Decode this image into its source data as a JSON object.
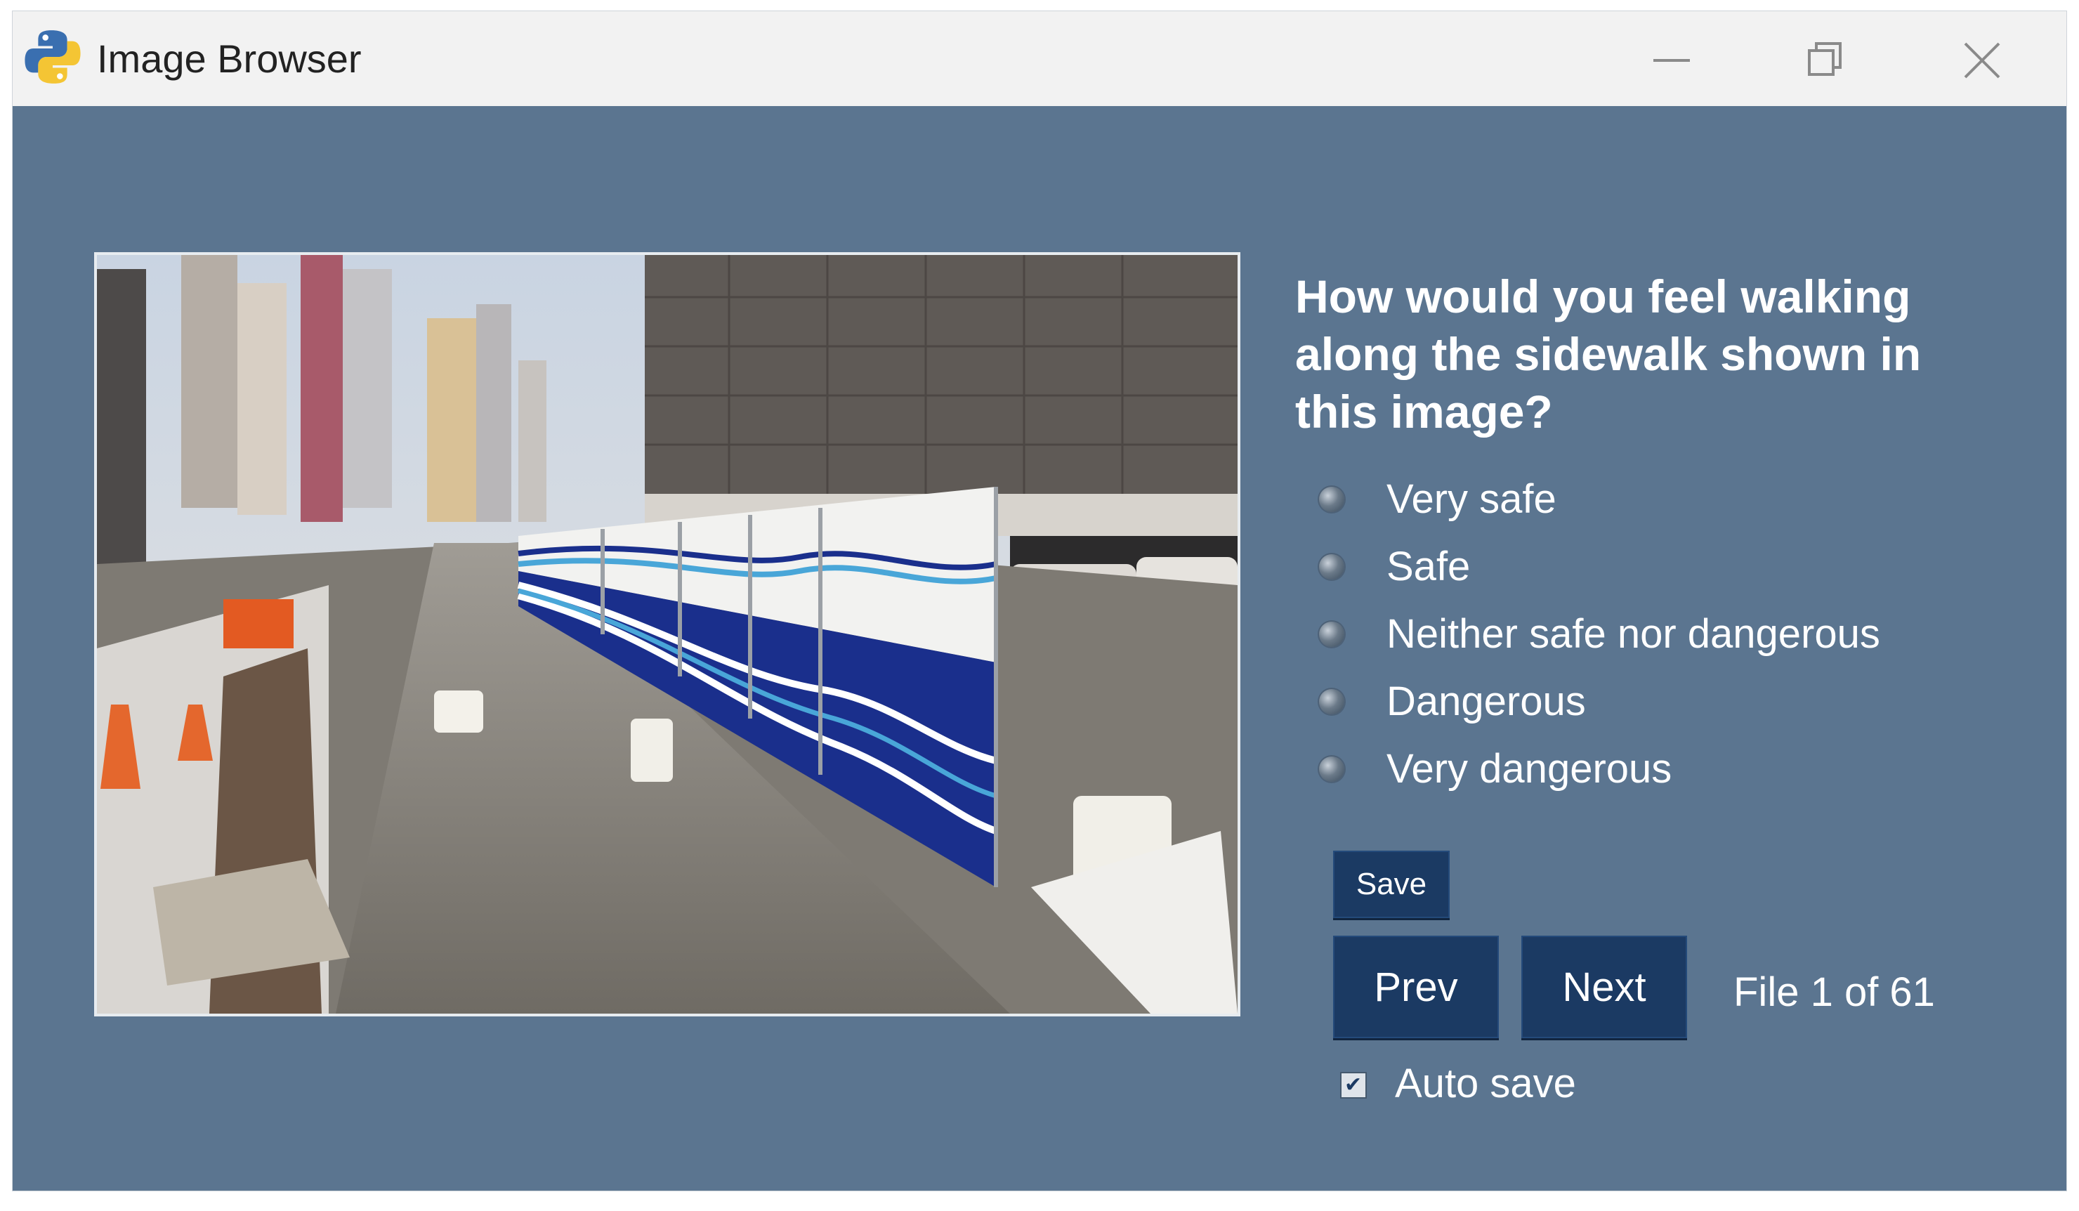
{
  "window": {
    "title": "Image Browser",
    "icon": "python-icon"
  },
  "titlebar_controls": [
    "minimize-icon",
    "restore-icon",
    "close-icon"
  ],
  "question": "How would you feel walking along the sidewalk shown in this image?",
  "options": [
    {
      "label": "Very safe",
      "selected": false
    },
    {
      "label": "Safe",
      "selected": false
    },
    {
      "label": "Neither safe nor dangerous",
      "selected": false
    },
    {
      "label": "Dangerous",
      "selected": false
    },
    {
      "label": "Very dangerous",
      "selected": false
    }
  ],
  "buttons": {
    "save": "Save",
    "prev": "Prev",
    "next": "Next"
  },
  "file_counter": "File 1 of 61",
  "autosave": {
    "label": "Auto save",
    "checked": true
  },
  "colors": {
    "background": "#5b7590",
    "button": "#1b3a63",
    "text": "#ffffff",
    "titlebar": "#f2f2f2"
  }
}
